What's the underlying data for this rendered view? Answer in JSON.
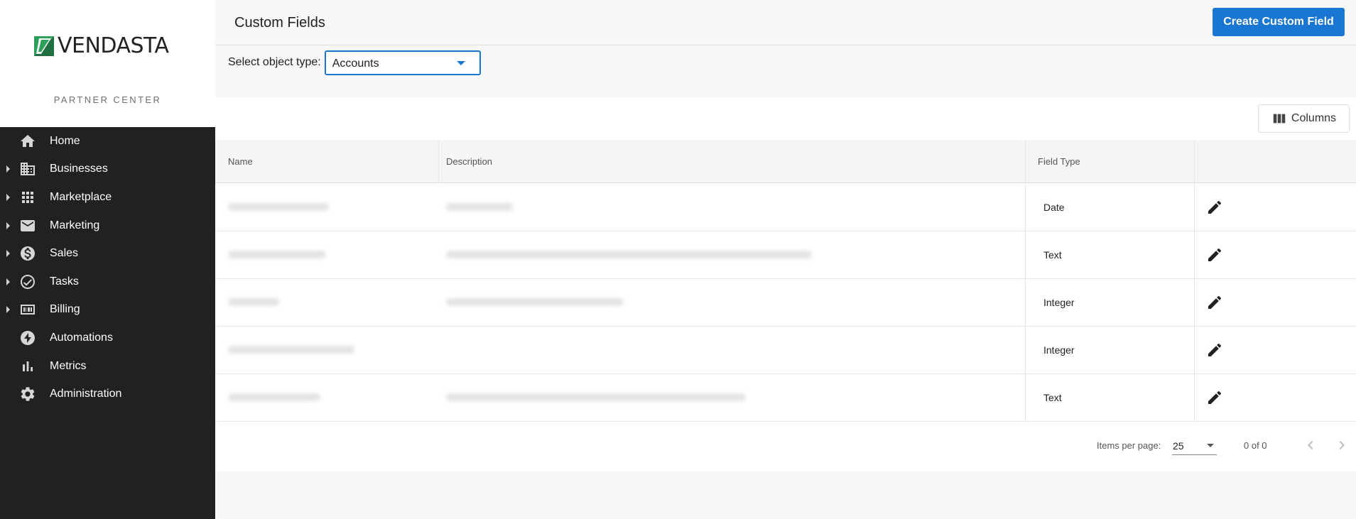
{
  "brand": {
    "logo_text": "VENDASTA",
    "subtitle": "PARTNER CENTER",
    "logo_color": "#2e9e5b"
  },
  "nav": {
    "items": [
      {
        "label": "Home",
        "icon": "home-icon",
        "expandable": false
      },
      {
        "label": "Businesses",
        "icon": "building-icon",
        "expandable": true
      },
      {
        "label": "Marketplace",
        "icon": "grid-icon",
        "expandable": true
      },
      {
        "label": "Marketing",
        "icon": "mail-icon",
        "expandable": true
      },
      {
        "label": "Sales",
        "icon": "dollar-icon",
        "expandable": true
      },
      {
        "label": "Tasks",
        "icon": "check-circle-icon",
        "expandable": true
      },
      {
        "label": "Billing",
        "icon": "billing-icon",
        "expandable": true
      },
      {
        "label": "Automations",
        "icon": "bolt-icon",
        "expandable": false
      },
      {
        "label": "Metrics",
        "icon": "bar-chart-icon",
        "expandable": false
      },
      {
        "label": "Administration",
        "icon": "gear-icon",
        "expandable": false
      }
    ]
  },
  "header": {
    "title": "Custom Fields",
    "create_label": "Create Custom Field"
  },
  "filter": {
    "label": "Select object type:",
    "value": "Accounts"
  },
  "table": {
    "columns_button": "Columns",
    "headers": {
      "name": "Name",
      "description": "Description",
      "field_type": "Field Type"
    },
    "rows": [
      {
        "field_type": "Date"
      },
      {
        "field_type": "Text"
      },
      {
        "field_type": "Integer"
      },
      {
        "field_type": "Integer"
      },
      {
        "field_type": "Text"
      }
    ]
  },
  "pagination": {
    "items_per_page_label": "Items per page:",
    "page_size": "25",
    "range": "0 of 0"
  },
  "colors": {
    "primary": "#1976d2",
    "sidebar": "#212121"
  }
}
